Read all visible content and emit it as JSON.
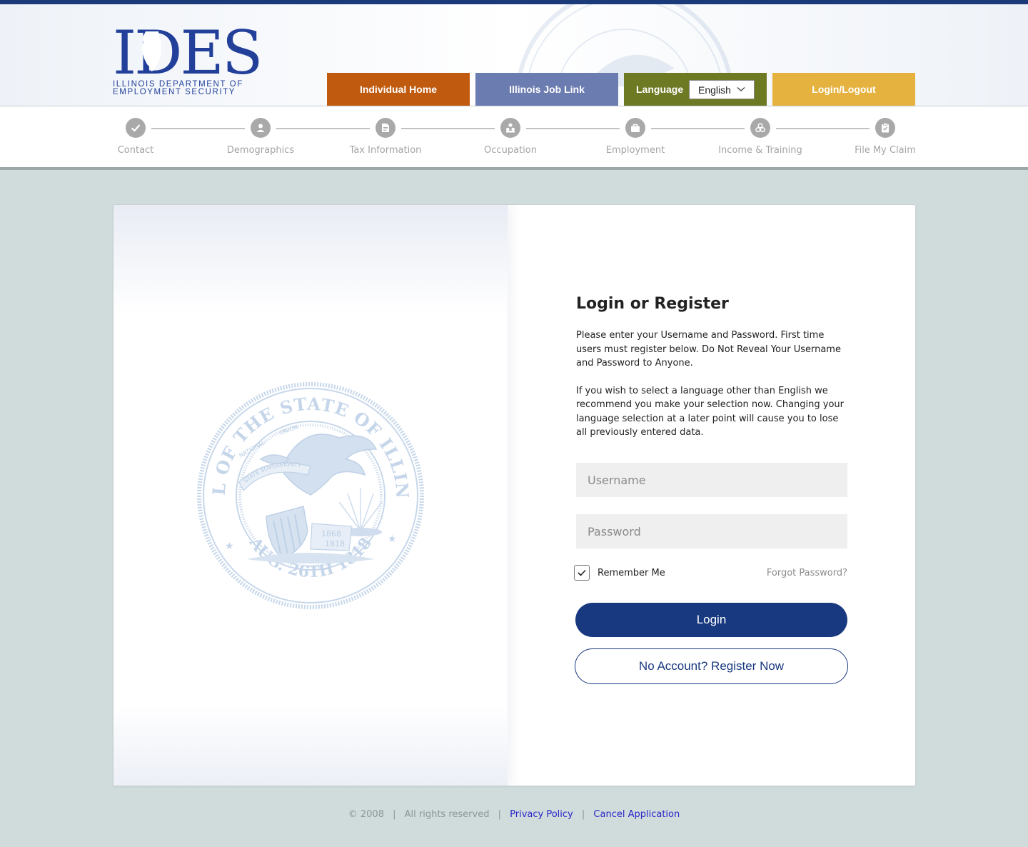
{
  "header": {
    "logo_text": "IDES",
    "logo_sub_line1": "ILLINOIS DEPARTMENT OF",
    "logo_sub_line2": "EMPLOYMENT SECURITY",
    "nav": {
      "individual_home": "Individual Home",
      "job_link": "Illinois Job Link",
      "language_label": "Language",
      "language_selected": "English",
      "login_logout": "Login/Logout"
    },
    "colors": {
      "individual_home": "#c05a0e",
      "job_link": "#6b7cb0",
      "language": "#6e7a23",
      "login_logout": "#e5b23f",
      "brand_blue": "#18387f"
    }
  },
  "stepper": {
    "steps": [
      {
        "label": "Contact",
        "icon": "check-icon"
      },
      {
        "label": "Demographics",
        "icon": "person-icon"
      },
      {
        "label": "Tax Information",
        "icon": "document-icon"
      },
      {
        "label": "Occupation",
        "icon": "people-icon"
      },
      {
        "label": "Employment",
        "icon": "briefcase-icon"
      },
      {
        "label": "Income & Training",
        "icon": "coins-icon"
      },
      {
        "label": "File My Claim",
        "icon": "clipboard-check-icon"
      }
    ]
  },
  "seal": {
    "ring_text": "SEAL OF THE STATE OF ILLINOIS",
    "date_text": "AUG. 26TH 1818",
    "year1": "1868",
    "year2": "1818",
    "banner": "STATE SOVEREIGNTY",
    "union": "UNION",
    "national": "NATIONAL"
  },
  "login": {
    "title": "Login or Register",
    "paragraph1": "Please enter your Username and Password. First time users must register below. Do Not Reveal Your Username and Password to Anyone.",
    "paragraph2": "If you wish to select a language other than English we recommend you make your selection now. Changing your language selection at a later point will cause you to lose all previously entered data.",
    "username_placeholder": "Username",
    "password_placeholder": "Password",
    "remember_me": "Remember Me",
    "remember_checked": true,
    "forgot_password": "Forgot Password?",
    "login_button": "Login",
    "register_button": "No Account? Register Now"
  },
  "footer": {
    "copyright": "© 2008",
    "rights": "All rights reserved",
    "privacy": "Privacy Policy",
    "cancel": "Cancel Application",
    "separator": "|"
  }
}
